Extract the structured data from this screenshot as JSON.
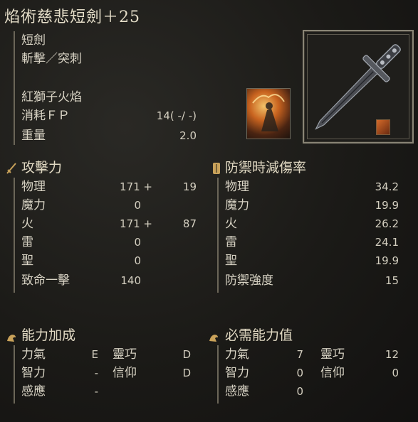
{
  "weapon": {
    "name": "焰術慈悲短劍＋25",
    "type": "短劍",
    "attack_type": "斬擊／突刺",
    "skill_name": "紅獅子火焰",
    "fp_label": "消耗ＦＰ",
    "fp_value": "14( -/ -)",
    "weight_label": "重量",
    "weight_value": "2.0"
  },
  "attack": {
    "header": "攻擊力",
    "rows": [
      {
        "label": "物理",
        "value": "171 +",
        "bonus": "19"
      },
      {
        "label": "魔力",
        "value": "0",
        "bonus": ""
      },
      {
        "label": "火",
        "value": "171 +",
        "bonus": "87"
      },
      {
        "label": "雷",
        "value": "0",
        "bonus": ""
      },
      {
        "label": "聖",
        "value": "0",
        "bonus": ""
      },
      {
        "label": "致命一擊",
        "value": "140",
        "bonus": ""
      }
    ]
  },
  "guard": {
    "header": "防禦時減傷率",
    "rows": [
      {
        "label": "物理",
        "value": "34.2"
      },
      {
        "label": "魔力",
        "value": "19.9"
      },
      {
        "label": "火",
        "value": "26.2"
      },
      {
        "label": "雷",
        "value": "24.1"
      },
      {
        "label": "聖",
        "value": "19.9"
      },
      {
        "label": "防禦強度",
        "value": "15"
      }
    ]
  },
  "scaling": {
    "header": "能力加成",
    "rows": [
      {
        "l1": "力氣",
        "v1": "E",
        "l2": "靈巧",
        "v2": "D"
      },
      {
        "l1": "智力",
        "v1": "-",
        "l2": "信仰",
        "v2": "D"
      },
      {
        "l1": "感應",
        "v1": "-",
        "l2": "",
        "v2": ""
      }
    ]
  },
  "requirements": {
    "header": "必需能力值",
    "rows": [
      {
        "l1": "力氣",
        "v1": "7",
        "l2": "靈巧",
        "v2": "12"
      },
      {
        "l1": "智力",
        "v1": "0",
        "l2": "信仰",
        "v2": "0"
      },
      {
        "l1": "感應",
        "v1": "0",
        "l2": "",
        "v2": ""
      }
    ]
  },
  "colors": {
    "accent": "#c9a25a",
    "text": "#d8d3c4"
  }
}
